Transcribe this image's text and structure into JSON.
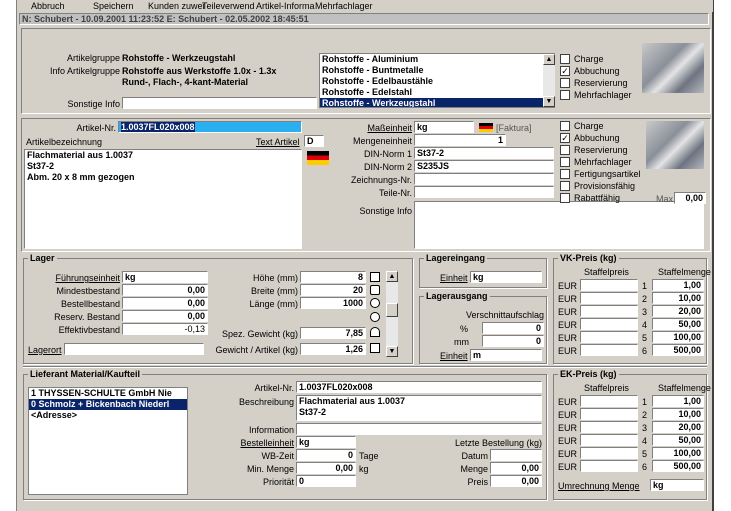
{
  "menu": [
    "Abbruch",
    "Speichern",
    "Kunden zuwei",
    "Teileverwend",
    "Artikel-Informa",
    "Mehrfachlager"
  ],
  "status": "N: Schubert - 10.09.2001 11:23:52    E: Schubert - 02.05.2002 18:45:51",
  "group": {
    "artikelgruppe_label": "Artikelgruppe",
    "artikelgruppe": "Rohstoffe - Werkzeugstahl",
    "info_label": "Info Artikelgruppe",
    "info_line1": "Rohstoffe aus Werkstoffe 1.0x - 1.3x",
    "info_line2": "Rund-, Flach-, 4-kant-Material",
    "sonstige_label": "Sonstige Info",
    "sonstige": "",
    "list": [
      "Rohstoffe - Aluminium",
      "Rohstoffe - Buntmetalle",
      "Rohstoffe - Edelbaustähle",
      "Rohstoffe - Edelstahl",
      "Rohstoffe - Werkzeugstahl"
    ],
    "checks": [
      {
        "label": "Charge",
        "checked": ""
      },
      {
        "label": "Abbuchung",
        "checked": "✓"
      },
      {
        "label": "Reservierung",
        "checked": ""
      },
      {
        "label": "Mehrfachlager",
        "checked": ""
      }
    ]
  },
  "article": {
    "nr_label": "Artikel-Nr.",
    "nr": "1.0037FL020x008",
    "bez_label": "Artikelbezeichnung",
    "text_label": "Text Artikel",
    "lang": "D",
    "desc1": "Flachmaterial  aus 1.0037",
    "desc2": "St37-2",
    "desc3": "Abm. 20 x 8 mm gezogen",
    "me_label": "Maßeinheit",
    "me": "kg",
    "faktura": "[Faktura]",
    "mengen_label": "Mengeneinheit",
    "mengen": "1",
    "din1_label": "DIN-Norm 1",
    "din1": "St37-2",
    "din2_label": "DIN-Norm 2",
    "din2": "S235JS",
    "zeich_label": "Zeichnungs-Nr.",
    "teile_label": "Teile-Nr.",
    "sonst_label": "Sonstige Info",
    "checks": [
      {
        "label": "Charge",
        "checked": ""
      },
      {
        "label": "Abbuchung",
        "checked": "✓"
      },
      {
        "label": "Reservierung",
        "checked": ""
      },
      {
        "label": "Mehrfachlager",
        "checked": ""
      },
      {
        "label": "Fertigungsartikel",
        "checked": ""
      },
      {
        "label": "Provisionsfähig",
        "checked": ""
      },
      {
        "label": "Rabattfähig",
        "checked": ""
      }
    ],
    "max_label": "Max",
    "max": "0,00"
  },
  "lager": {
    "title": "Lager",
    "fe_label": "Führungseinheit",
    "fe": "kg",
    "rows": [
      {
        "label": "Mindestbestand",
        "value": "0,00"
      },
      {
        "label": "Bestellbestand",
        "value": "0,00"
      },
      {
        "label": "Reserv. Bestand",
        "value": "0,00"
      },
      {
        "label": "Effektivbestand",
        "value": "-0,13"
      }
    ],
    "hoehe_label": "Höhe (mm)",
    "hoehe": "8",
    "breite_label": "Breite (mm)",
    "breite": "20",
    "laenge_label": "Länge (mm)",
    "laenge": "1000",
    "spez_label": "Spez. Gewicht (kg)",
    "spez": "7,85",
    "gew_label": "Gewicht / Artikel (kg)",
    "gew": "1,26",
    "ort_label": "Lagerort",
    "ort": ""
  },
  "eingang": {
    "title": "Lagereingang",
    "einheit_label": "Einheit",
    "einheit": "kg"
  },
  "ausgang": {
    "title": "Lagerausgang",
    "vs_label": "Verschnittaufschlag",
    "pct_label": "%",
    "pct": "0",
    "mm_label": "mm",
    "mm": "0",
    "einheit_label": "Einheit",
    "einheit": "m"
  },
  "vk": {
    "title": "VK-Preis (kg)",
    "col1": "Staffelpreis",
    "col2": "Staffelmenge",
    "rows": [
      {
        "cur": "EUR",
        "n": "1",
        "menge": "1,00"
      },
      {
        "cur": "EUR",
        "n": "2",
        "menge": "10,00"
      },
      {
        "cur": "EUR",
        "n": "3",
        "menge": "20,00"
      },
      {
        "cur": "EUR",
        "n": "4",
        "menge": "50,00"
      },
      {
        "cur": "EUR",
        "n": "5",
        "menge": "100,00"
      },
      {
        "cur": "EUR",
        "n": "6",
        "menge": "500,00"
      }
    ]
  },
  "ek": {
    "title": "EK-Preis (kg)",
    "col1": "Staffelpreis",
    "col2": "Staffelmenge",
    "rows": [
      {
        "cur": "EUR",
        "n": "1",
        "menge": "1,00"
      },
      {
        "cur": "EUR",
        "n": "2",
        "menge": "10,00"
      },
      {
        "cur": "EUR",
        "n": "3",
        "menge": "20,00"
      },
      {
        "cur": "EUR",
        "n": "4",
        "menge": "50,00"
      },
      {
        "cur": "EUR",
        "n": "5",
        "menge": "100,00"
      },
      {
        "cur": "EUR",
        "n": "6",
        "menge": "500,00"
      }
    ],
    "um_label": "Umrechnung Menge",
    "um": "kg"
  },
  "supplier": {
    "title": "Lieferant Material/Kaufteil",
    "list": [
      "1 THYSSEN-SCHULTE GmbH Nie",
      "0 Schmolz + Bickenbach Niederl",
      "<Adresse>"
    ],
    "nr_label": "Artikel-Nr.",
    "nr": "1.0037FL020x008",
    "beschr_label": "Beschreibung",
    "beschr1": "Flachmaterial  aus 1.0037",
    "beschr2": "St37-2",
    "info_label": "Information",
    "be_label": "Bestelleinheit",
    "be": "kg",
    "wb_label": "WB-Zeit",
    "wb": "0",
    "tage": "Tage",
    "min_label": "Min. Menge",
    "min": "0,00",
    "min_unit": "kg",
    "prio_label": "Priorität",
    "prio": "0",
    "lb_label": "Letzte Bestellung (kg)",
    "datum_label": "Datum",
    "menge_label": "Menge",
    "menge": "0,00",
    "preis_label": "Preis",
    "preis": "0,00"
  }
}
